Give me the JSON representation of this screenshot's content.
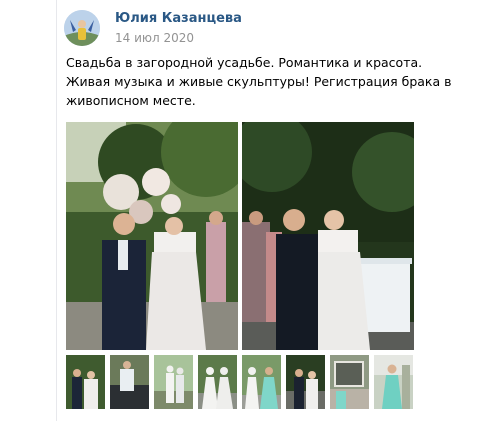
{
  "post": {
    "author": "Юлия Казанцева",
    "date": "14 июл 2020",
    "text_lines": [
      "Свадьба в загородной усадьбе. Романтика и красота.",
      "Живая музыка и живые скульптуры! Регистрация брака в",
      "живописном месте."
    ]
  },
  "photos": {
    "main_count": 2,
    "thumbnail_count": 8
  },
  "colors": {
    "author_link": "#2a5885",
    "date_gray": "#939393",
    "divider": "#e7e8ec"
  },
  "icons": [
    "avatar-icon"
  ]
}
